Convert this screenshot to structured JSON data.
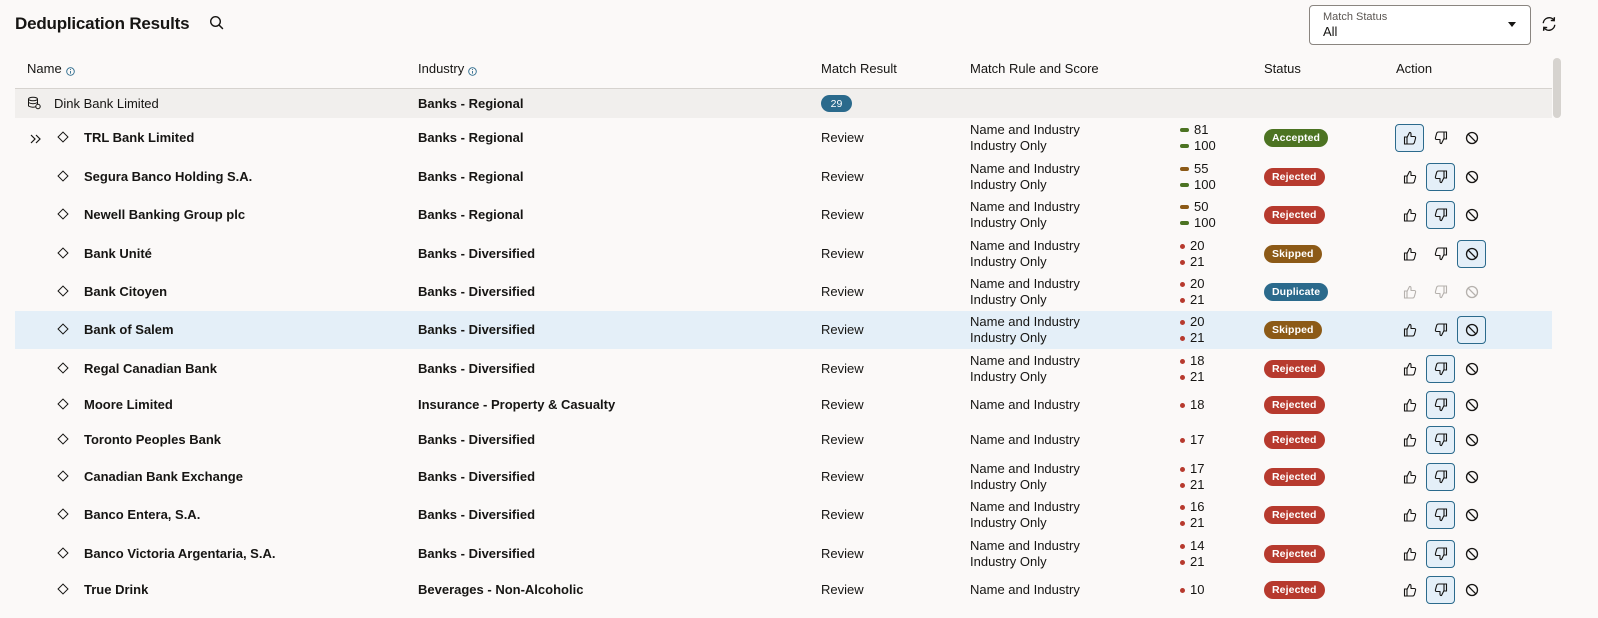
{
  "header": {
    "title": "Deduplication Results",
    "filter": {
      "label": "Match Status",
      "value": "All"
    }
  },
  "columns": {
    "name": "Name",
    "industry": "Industry",
    "match_result": "Match Result",
    "match_rule": "Match Rule and Score",
    "status": "Status",
    "action": "Action"
  },
  "group": {
    "name": "Dink Bank Limited",
    "industry": "Banks - Regional",
    "count": "29"
  },
  "colors": {
    "accepted": "#4c7322",
    "rejected": "#b73a2e",
    "skipped": "#8c5a17",
    "duplicate": "#2b6a8c",
    "score_green": "#4c7322",
    "score_orange": "#8c5a17",
    "score_red": "#b73a2e"
  },
  "rows": [
    {
      "name": "TRL Bank Limited",
      "industry": "Banks - Regional",
      "result": "Review",
      "rules": [
        "Name and Industry",
        "Industry Only"
      ],
      "scores": [
        {
          "v": "81",
          "c": "score_green",
          "shape": "bar"
        },
        {
          "v": "100",
          "c": "score_green",
          "shape": "bar"
        }
      ],
      "status": "Accepted",
      "status_color": "accepted",
      "active": "like",
      "expanded": true
    },
    {
      "name": "Segura Banco Holding S.A.",
      "industry": "Banks - Regional",
      "result": "Review",
      "rules": [
        "Name and Industry",
        "Industry Only"
      ],
      "scores": [
        {
          "v": "55",
          "c": "score_orange",
          "shape": "bar"
        },
        {
          "v": "100",
          "c": "score_green",
          "shape": "bar"
        }
      ],
      "status": "Rejected",
      "status_color": "rejected",
      "active": "dislike"
    },
    {
      "name": "Newell Banking Group plc",
      "industry": "Banks - Regional",
      "result": "Review",
      "rules": [
        "Name and Industry",
        "Industry Only"
      ],
      "scores": [
        {
          "v": "50",
          "c": "score_orange",
          "shape": "bar"
        },
        {
          "v": "100",
          "c": "score_green",
          "shape": "bar"
        }
      ],
      "status": "Rejected",
      "status_color": "rejected",
      "active": "dislike"
    },
    {
      "name": "Bank Unité",
      "industry": "Banks - Diversified",
      "result": "Review",
      "rules": [
        "Name and Industry",
        "Industry Only"
      ],
      "scores": [
        {
          "v": "20",
          "c": "score_red",
          "shape": "round"
        },
        {
          "v": "21",
          "c": "score_red",
          "shape": "round"
        }
      ],
      "status": "Skipped",
      "status_color": "skipped",
      "active": "skip"
    },
    {
      "name": "Bank Citoyen",
      "industry": "Banks - Diversified",
      "result": "Review",
      "rules": [
        "Name and Industry",
        "Industry Only"
      ],
      "scores": [
        {
          "v": "20",
          "c": "score_red",
          "shape": "round"
        },
        {
          "v": "21",
          "c": "score_red",
          "shape": "round"
        }
      ],
      "status": "Duplicate",
      "status_color": "duplicate",
      "active": "none",
      "disabled": true
    },
    {
      "name": "Bank of Salem",
      "industry": "Banks - Diversified",
      "result": "Review",
      "rules": [
        "Name and Industry",
        "Industry Only"
      ],
      "scores": [
        {
          "v": "20",
          "c": "score_red",
          "shape": "round"
        },
        {
          "v": "21",
          "c": "score_red",
          "shape": "round"
        }
      ],
      "status": "Skipped",
      "status_color": "skipped",
      "active": "skip",
      "selected": true
    },
    {
      "name": "Regal Canadian Bank",
      "industry": "Banks - Diversified",
      "result": "Review",
      "rules": [
        "Name and Industry",
        "Industry Only"
      ],
      "scores": [
        {
          "v": "18",
          "c": "score_red",
          "shape": "round"
        },
        {
          "v": "21",
          "c": "score_red",
          "shape": "round"
        }
      ],
      "status": "Rejected",
      "status_color": "rejected",
      "active": "dislike"
    },
    {
      "name": "Moore Limited",
      "industry": "Insurance - Property & Casualty",
      "result": "Review",
      "rules": [
        "Name and Industry"
      ],
      "scores": [
        {
          "v": "18",
          "c": "score_red",
          "shape": "round"
        }
      ],
      "status": "Rejected",
      "status_color": "rejected",
      "active": "dislike"
    },
    {
      "name": "Toronto Peoples Bank",
      "industry": "Banks - Diversified",
      "result": "Review",
      "rules": [
        "Name and Industry"
      ],
      "scores": [
        {
          "v": "17",
          "c": "score_red",
          "shape": "round"
        }
      ],
      "status": "Rejected",
      "status_color": "rejected",
      "active": "dislike"
    },
    {
      "name": "Canadian Bank Exchange",
      "industry": "Banks - Diversified",
      "result": "Review",
      "rules": [
        "Name and Industry",
        "Industry Only"
      ],
      "scores": [
        {
          "v": "17",
          "c": "score_red",
          "shape": "round"
        },
        {
          "v": "21",
          "c": "score_red",
          "shape": "round"
        }
      ],
      "status": "Rejected",
      "status_color": "rejected",
      "active": "dislike"
    },
    {
      "name": "Banco Entera, S.A.",
      "industry": "Banks - Diversified",
      "result": "Review",
      "rules": [
        "Name and Industry",
        "Industry Only"
      ],
      "scores": [
        {
          "v": "16",
          "c": "score_red",
          "shape": "round"
        },
        {
          "v": "21",
          "c": "score_red",
          "shape": "round"
        }
      ],
      "status": "Rejected",
      "status_color": "rejected",
      "active": "dislike"
    },
    {
      "name": "Banco Victoria Argentaria, S.A.",
      "industry": "Banks - Diversified",
      "result": "Review",
      "rules": [
        "Name and Industry",
        "Industry Only"
      ],
      "scores": [
        {
          "v": "14",
          "c": "score_red",
          "shape": "round"
        },
        {
          "v": "21",
          "c": "score_red",
          "shape": "round"
        }
      ],
      "status": "Rejected",
      "status_color": "rejected",
      "active": "dislike"
    },
    {
      "name": "True Drink",
      "industry": "Beverages - Non-Alcoholic",
      "result": "Review",
      "rules": [
        "Name and Industry"
      ],
      "scores": [
        {
          "v": "10",
          "c": "score_red",
          "shape": "round"
        }
      ],
      "status": "Rejected",
      "status_color": "rejected",
      "active": "dislike"
    }
  ]
}
